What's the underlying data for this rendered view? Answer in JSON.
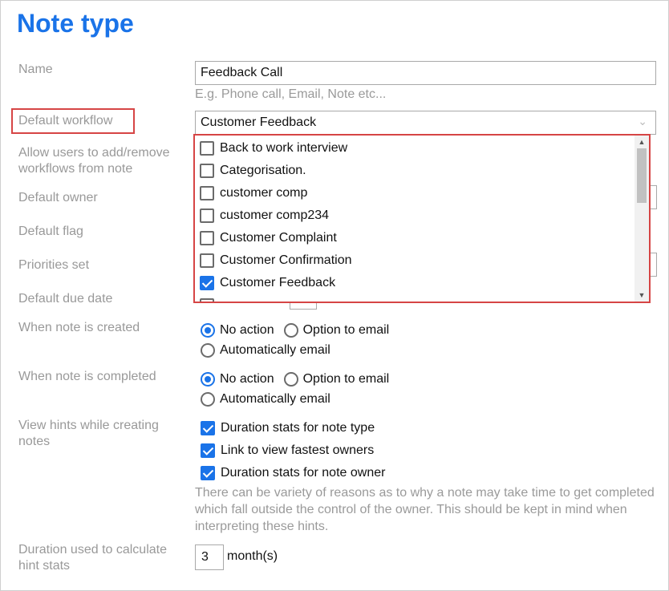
{
  "page": {
    "title": "Note type"
  },
  "fields": {
    "name": {
      "label": "Name",
      "value": "Feedback Call",
      "hint": "E.g. Phone call, Email, Note etc..."
    },
    "default_workflow": {
      "label": "Default workflow",
      "value": "Customer Feedback"
    },
    "allow_users": {
      "label": "Allow users to add/remove workflows from note"
    },
    "default_owner": {
      "label": "Default owner"
    },
    "default_flag": {
      "label": "Default flag"
    },
    "priorities_set": {
      "label": "Priorities set"
    },
    "default_due_date": {
      "label": "Default due date"
    },
    "when_created": {
      "label": "When note is created",
      "options": [
        "No action",
        "Option to email",
        "Automatically email"
      ],
      "selected": "No action"
    },
    "when_completed": {
      "label": "When note is completed",
      "options": [
        "No action",
        "Option to email",
        "Automatically email"
      ],
      "selected": "No action"
    },
    "view_hints": {
      "label": "View hints while creating notes",
      "checks": [
        {
          "label": "Duration stats for note type",
          "checked": true
        },
        {
          "label": "Link to view fastest owners",
          "checked": true
        },
        {
          "label": "Duration stats for note owner",
          "checked": true
        }
      ],
      "note": "There can be variety of reasons as to why a note may take time to get completed which fall outside the control of the owner. This should be kept in mind when interpreting these hints."
    },
    "duration": {
      "label": "Duration used to calculate hint stats",
      "value": "3",
      "unit": "month(s)"
    }
  },
  "workflow_dropdown": {
    "items": [
      {
        "label": "Back to work interview",
        "checked": false
      },
      {
        "label": "Categorisation.",
        "checked": false
      },
      {
        "label": "customer comp",
        "checked": false
      },
      {
        "label": "customer comp234",
        "checked": false
      },
      {
        "label": "Customer Complaint",
        "checked": false
      },
      {
        "label": "Customer Confirmation",
        "checked": false
      },
      {
        "label": "Customer Feedback",
        "checked": true
      }
    ]
  },
  "colors": {
    "accent": "#1a73e8",
    "highlight": "#d64545",
    "label": "#999999"
  }
}
